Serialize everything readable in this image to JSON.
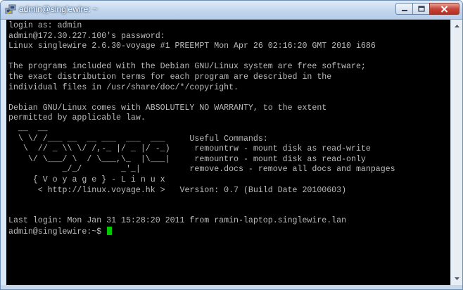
{
  "window": {
    "title": "admin@singlewire: ~"
  },
  "terminal": {
    "lines": [
      "login as: admin",
      "admin@172.30.227.100's password:",
      "Linux singlewire 2.6.30-voyage #1 PREEMPT Mon Apr 26 02:16:20 GMT 2010 i686",
      "",
      "The programs included with the Debian GNU/Linux system are free software;",
      "the exact distribution terms for each program are described in the",
      "individual files in /usr/share/doc/*/copyright.",
      "",
      "Debian GNU/Linux comes with ABSOLUTELY NO WARRANTY, to the extent",
      "permitted by applicable law.",
      "  __  __",
      "  \\ \\/ /___ __  __ ___  ___  ___     Useful Commands:",
      "   \\  // _ \\\\ \\/ /,-_ |/ _ |/ -_)     remountrw - mount disk as read-write",
      "    \\/ \\___/ \\  / \\___,\\_  |\\___|     remountro - mount disk as read-only",
      "           _/_/        _'_|          remove.docs - remove all docs and manpages",
      "     { V o y a g e } - L i n u x",
      "      < http://linux.voyage.hk >   Version: 0.7 (Build Date 20100603)",
      "",
      "",
      "Last login: Mon Jan 31 15:28:20 2011 from ramin-laptop.singlewire.lan"
    ],
    "prompt": "admin@singlewire:~$ "
  },
  "icons": {
    "app": "putty-icon",
    "minimize": "minimize-icon",
    "maximize": "maximize-icon",
    "close": "close-icon",
    "scroll_up": "scroll-up-arrow-icon",
    "scroll_down": "scroll-down-arrow-icon"
  },
  "colors": {
    "terminal_bg": "#000000",
    "terminal_fg": "#bbbbbb",
    "cursor": "#00c800",
    "close_button": "#c8453a",
    "titlebar": "#c3d6ee"
  }
}
